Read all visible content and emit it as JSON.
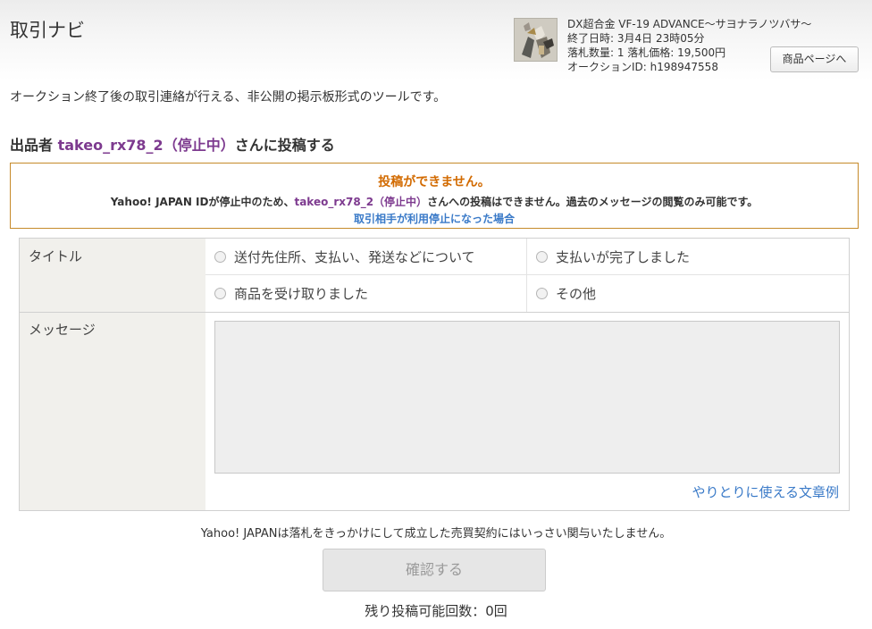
{
  "header": {
    "title": "取引ナビ",
    "product_page_button": "商品ページへ"
  },
  "product": {
    "name": "DX超合金 VF-19 ADVANCE～サヨナラノツバサ～",
    "end_time": "終了日時: 3月4日 23時05分",
    "bid_info": "落札数量: 1 落札価格: 19,500円",
    "auction_id": "オークションID: h198947558"
  },
  "intro": "オークション終了後の取引連絡が行える、非公開の掲示板形式のツールです。",
  "post_heading": {
    "prefix": "出品者 ",
    "seller": "takeo_rx78_2（停止中）",
    "suffix": "さんに投稿する"
  },
  "error_box": {
    "title": "投稿ができません。",
    "desc_prefix": "Yahoo! JAPAN IDが停止中のため、",
    "desc_seller": "takeo_rx78_2（停止中）",
    "desc_suffix": "さんへの投稿はできません。過去のメッセージの閲覧のみ可能です。",
    "link": "取引相手が利用停止になった場合"
  },
  "form": {
    "title_label": "タイトル",
    "title_options": [
      "送付先住所、支払い、発送などについて",
      "支払いが完了しました",
      "商品を受け取りました",
      "その他"
    ],
    "message_label": "メッセージ",
    "message_value": "",
    "example_link": "やりとりに使える文章例"
  },
  "footer": {
    "disclaimer": "Yahoo! JAPANは落札をきっかけにして成立した売買契約にはいっさい関与いたしません。",
    "confirm_button": "確認する",
    "remaining": "残り投稿可能回数：0回"
  },
  "colors": {
    "seller_purple": "#7d3a8f",
    "warning_orange": "#d26a00",
    "link_blue": "#3a7ac8",
    "error_border": "#c68a2a"
  }
}
